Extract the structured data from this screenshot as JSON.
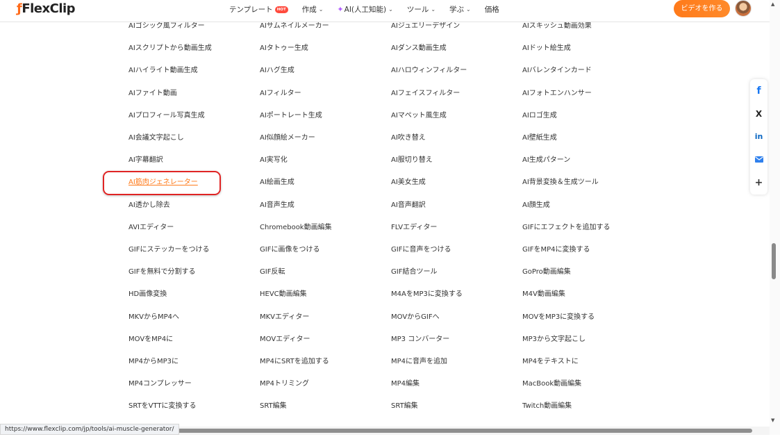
{
  "header": {
    "logo": "FlexClip",
    "nav": [
      {
        "label": "テンプレート",
        "badge": "HOT"
      },
      {
        "label": "作成",
        "chevron": true
      },
      {
        "label": "AI(人工知能)",
        "chevron": true,
        "sparkle": true
      },
      {
        "label": "ツール",
        "chevron": true
      },
      {
        "label": "学ぶ",
        "chevron": true
      },
      {
        "label": "価格"
      }
    ],
    "cta_label": "ビデオを作る"
  },
  "tools": {
    "columns": [
      [
        "AIゴシック風フィルター",
        "AIスクリプトから動画生成",
        "AIハイライト動画生成",
        "AIファイト動画",
        "AIプロフィール写真生成",
        "AI会議文字起こし",
        "AI字幕翻訳",
        "AI筋肉ジェネレーター",
        "AI透かし除去",
        "AVIエディター",
        "GIFにステッカーをつける",
        "GIFを無料で分割する",
        "HD画像変換",
        "MKVからMP4へ",
        "MOVをMP4に",
        "MP4からMP3に",
        "MP4コンプレッサー",
        "SRTをVTTに変換する"
      ],
      [
        "AIサムネイルメーカー",
        "AIタトゥー生成",
        "AIハグ生成",
        "AIフィルター",
        "AIポートレート生成",
        "AI似顔絵メーカー",
        "AI実写化",
        "AI絵画生成",
        "AI音声生成",
        "Chromebook動画編集",
        "GIFに画像をつける",
        "GIF反転",
        "HEVC動画編集",
        "MKVエディター",
        "MOVエディター",
        "MP4にSRTを追加する",
        "MP4トリミング",
        "SRT編集"
      ],
      [
        "AIジュエリーデザイン",
        "AIダンス動画生成",
        "AIハロウィンフィルター",
        "AIフェイスフィルター",
        "AIマペット風生成",
        "AI吹き替え",
        "AI服切り替え",
        "AI美女生成",
        "AI音声翻訳",
        "FLVエディター",
        "GIFに音声をつける",
        "GIF結合ツール",
        "M4AをMP3に変換する",
        "MOVからGIFへ",
        "MP3 コンバーター",
        "MP4に音声を追加",
        "MP4編集",
        "SRT編集"
      ],
      [
        "AIスキッシュ動画効果",
        "AIドット絵生成",
        "AIバレンタインカード",
        "AIフォトエンハンサー",
        "AIロゴ生成",
        "AI壁紙生成",
        "AI生成パターン",
        "AI背景変換＆生成ツール",
        "AI顔生成",
        "GIFにエフェクトを追加する",
        "GIFをMP4に変換する",
        "GoPro動画編集",
        "M4V動画編集",
        "MOVをMP3に変換する",
        "MP3から文字起こし",
        "MP4をテキストに",
        "MacBook動画編集",
        "Twitch動画編集"
      ]
    ],
    "active": "AI筋肉ジェネレーター"
  },
  "share": [
    "f",
    "X",
    "in",
    "email",
    "+"
  ],
  "status_url": "https://www.flexclip.com/jp/tools/ai-muscle-generator/",
  "colors": {
    "accent": "#ff7a1a",
    "highlight": "#e02424"
  }
}
